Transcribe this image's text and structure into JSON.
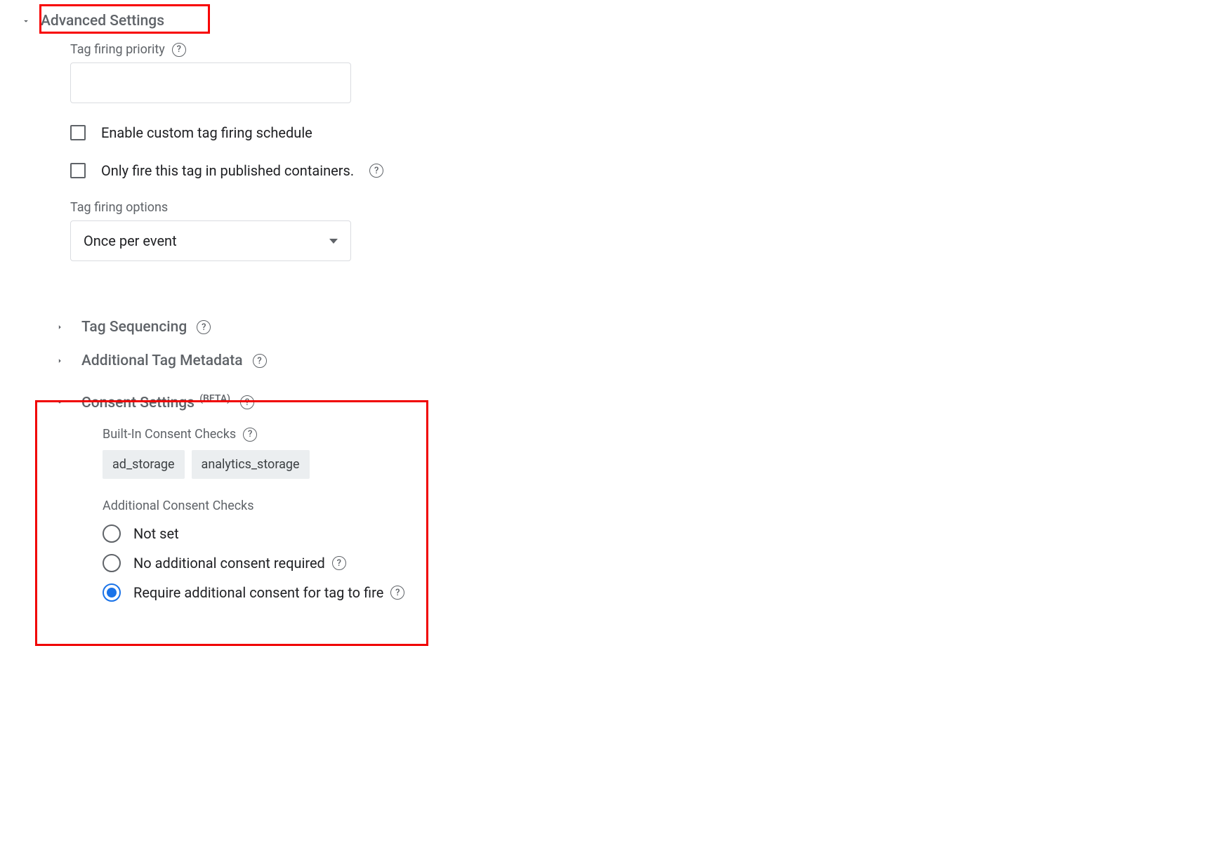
{
  "advanced": {
    "title": "Advanced Settings",
    "tagFiringPriority": {
      "label": "Tag firing priority",
      "value": ""
    },
    "enableCustomSchedule": {
      "label": "Enable custom tag firing schedule",
      "checked": false
    },
    "onlyFirePublished": {
      "label": "Only fire this tag in published containers.",
      "checked": false
    },
    "tagFiringOptions": {
      "label": "Tag firing options",
      "selected": "Once per event"
    },
    "tagSequencing": {
      "title": "Tag Sequencing"
    },
    "additionalMetadata": {
      "title": "Additional Tag Metadata"
    },
    "consent": {
      "title": "Consent Settings ",
      "badge": "(BETA)",
      "builtInLabel": "Built-In Consent Checks",
      "builtInTags": [
        "ad_storage",
        "analytics_storage"
      ],
      "additionalLabel": "Additional Consent Checks",
      "radios": [
        {
          "label": "Not set",
          "selected": false,
          "help": false
        },
        {
          "label": "No additional consent required",
          "selected": false,
          "help": true
        },
        {
          "label": "Require additional consent for tag to fire",
          "selected": true,
          "help": true
        }
      ]
    }
  }
}
